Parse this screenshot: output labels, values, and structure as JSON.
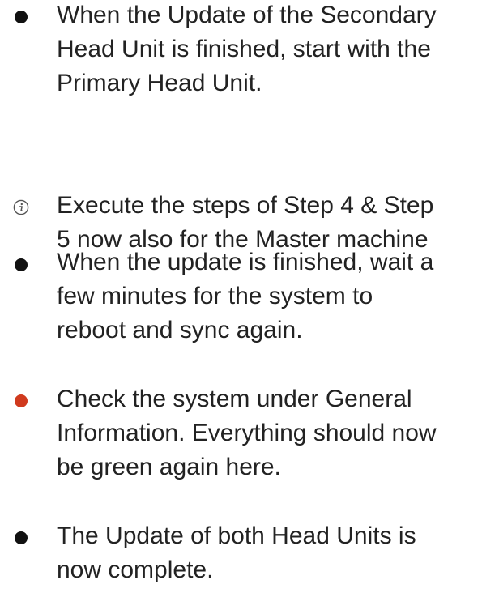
{
  "steps": [
    {
      "type": "bullet",
      "color": "#111111",
      "text": "When the Update of the Secondary\nHead Unit is finished, start with the\nPrimary Head Unit."
    },
    {
      "type": "info",
      "icon": "info-icon",
      "text": "Execute the steps of Step 4 & Step\n5 now also for the Master machine"
    },
    {
      "type": "bullet",
      "color": "#111111",
      "text": "When the update is finished, wait a\nfew minutes for the system to\nreboot and sync again."
    },
    {
      "type": "bullet",
      "color": "#d03a1e",
      "text": "Check the system under General\nInformation. Everything should now\nbe green again here."
    },
    {
      "type": "bullet",
      "color": "#111111",
      "text": "The Update of both Head Units is\nnow complete."
    }
  ]
}
